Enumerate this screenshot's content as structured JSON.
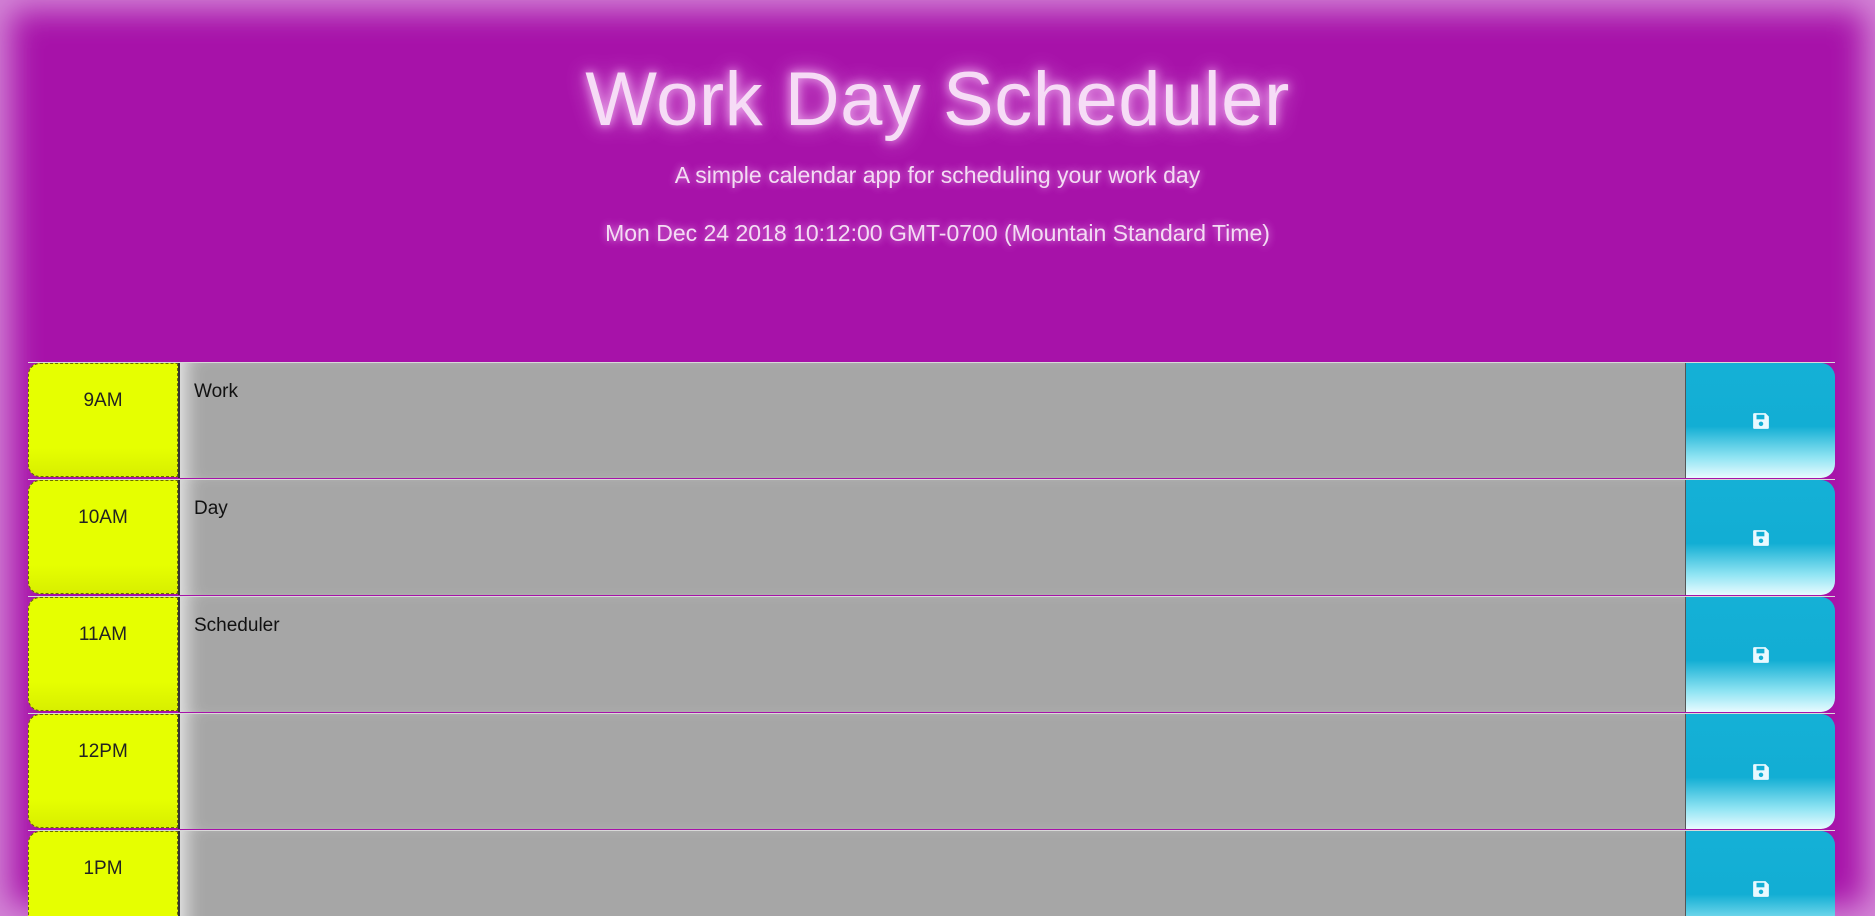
{
  "header": {
    "title": "Work Day Scheduler",
    "subtitle": "A simple calendar app for scheduling your work day",
    "datetime": "Mon Dec 24 2018 10:12:00 GMT-0700 (Mountain Standard Time)"
  },
  "rows": [
    {
      "hour": "9AM",
      "text": "Work"
    },
    {
      "hour": "10AM",
      "text": "Day"
    },
    {
      "hour": "11AM",
      "text": "Scheduler"
    },
    {
      "hour": "12PM",
      "text": ""
    },
    {
      "hour": "1PM",
      "text": ""
    }
  ],
  "icons": {
    "save": "save-icon"
  },
  "colors": {
    "background": "#a712a9",
    "hour_block": "#e6ff00",
    "description": "#a6a6a6",
    "save_button": "#12aed4"
  }
}
